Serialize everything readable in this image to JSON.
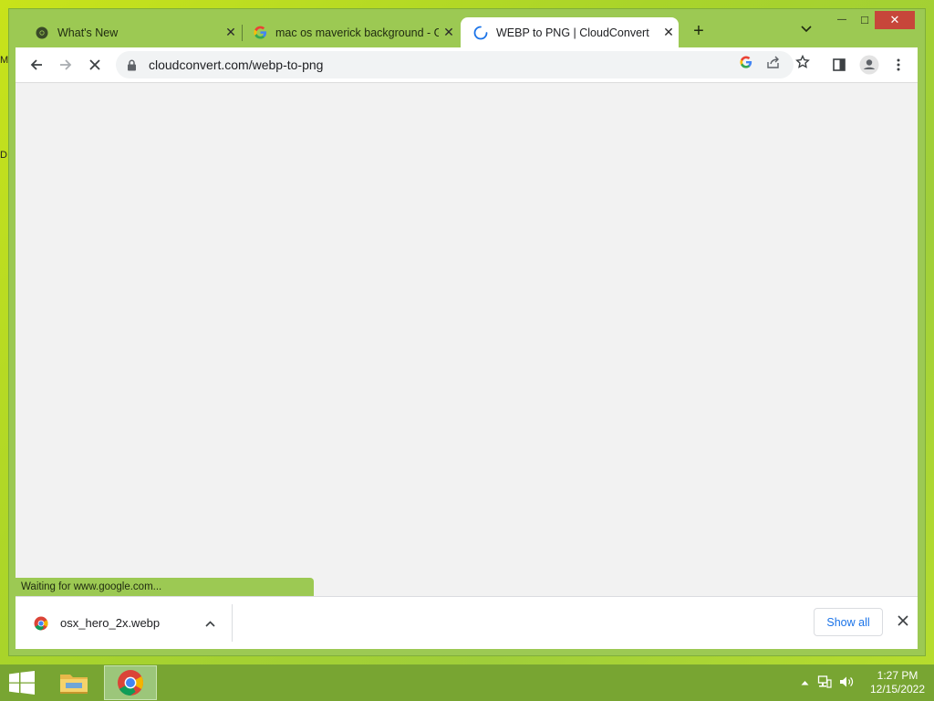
{
  "desktop": {
    "marks": [
      "M",
      "D"
    ]
  },
  "tabs": [
    {
      "title": "What's New",
      "icon": "chrome-icon",
      "close": "✕"
    },
    {
      "title": "mac os maverick background - G",
      "icon": "google-icon",
      "close": "✕"
    },
    {
      "title": "WEBP to PNG | CloudConvert",
      "icon": "loading-spinner-icon",
      "close": "✕"
    }
  ],
  "new_tab_label": "+",
  "window_controls": {
    "minimize": "—",
    "maximize": "□",
    "close": "✕"
  },
  "toolbar": {
    "url": "cloudconvert.com/webp-to-png",
    "icons": [
      "back-icon",
      "forward-icon",
      "stop-icon",
      "lock-icon",
      "google-lens-icon",
      "share-icon",
      "bookmark-star-icon",
      "side-panel-icon",
      "profile-icon",
      "menu-icon"
    ]
  },
  "status": {
    "text": "Waiting for www.google.com..."
  },
  "downloads": {
    "items": [
      {
        "name": "osx_hero_2x.webp"
      }
    ],
    "show_all_label": "Show all"
  },
  "taskbar": {
    "clock_time": "1:27 PM",
    "clock_date": "12/15/2022"
  },
  "colors": {
    "window_frame": "#9cc953",
    "taskbar": "#78a532",
    "accent_blue": "#1a73e8"
  }
}
